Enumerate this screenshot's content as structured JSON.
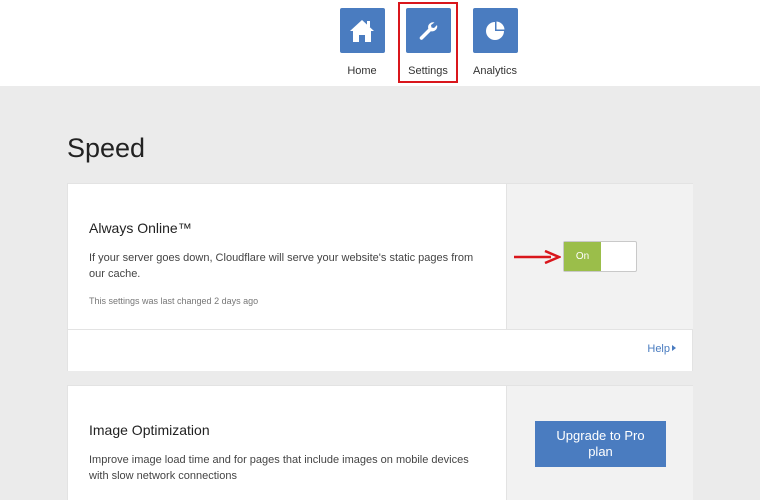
{
  "nav": {
    "items": [
      {
        "label": "Home",
        "icon": "home-icon"
      },
      {
        "label": "Settings",
        "icon": "wrench-icon",
        "highlighted": true
      },
      {
        "label": "Analytics",
        "icon": "pie-chart-icon"
      }
    ]
  },
  "page": {
    "title": "Speed"
  },
  "always_online": {
    "title": "Always Online™",
    "description": "If your server goes down, Cloudflare will serve your website's static pages from our cache.",
    "meta": "This settings was last changed 2 days ago",
    "toggle_label": "On",
    "toggle_state": "on",
    "help_label": "Help"
  },
  "image_optimization": {
    "title": "Image Optimization",
    "description": "Improve image load time and for pages that include images on mobile devices with slow network connections",
    "upgrade_label": "Upgrade to Pro plan"
  },
  "colors": {
    "accent": "#4a7cc0",
    "toggle_on": "#9bbe4a",
    "annotation": "#d9161c",
    "page_bg": "#ebebeb"
  }
}
